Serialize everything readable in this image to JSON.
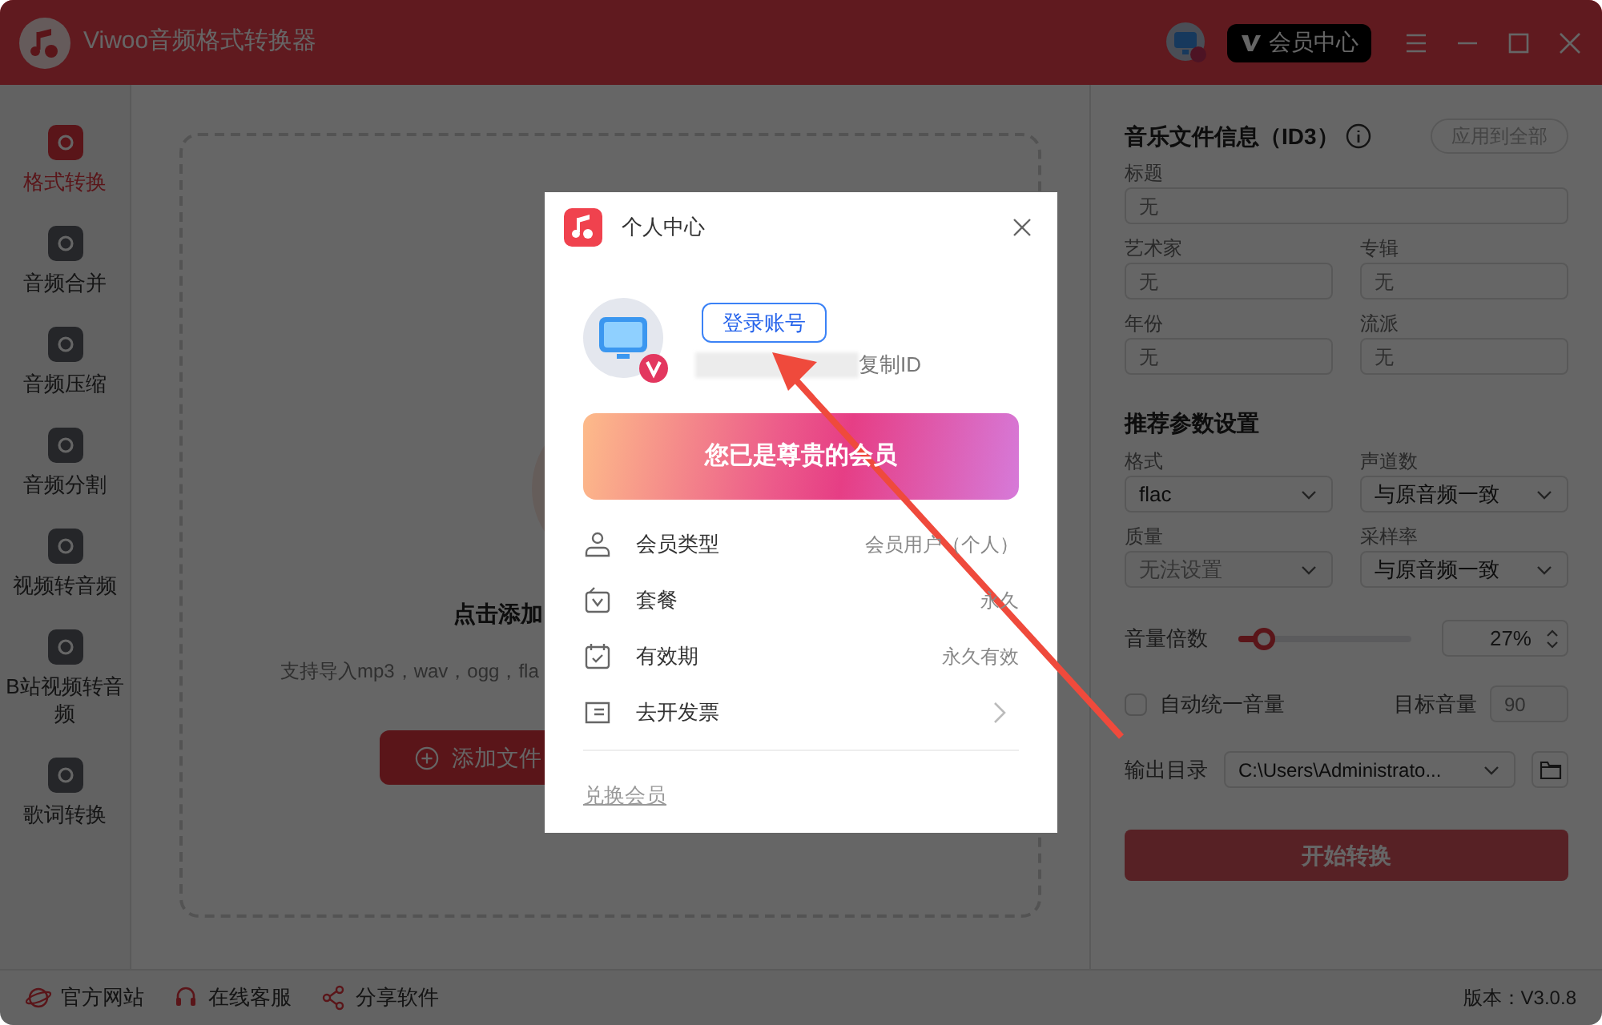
{
  "window": {
    "title": "Viwoo音频格式转换器",
    "member_button": "会员中心"
  },
  "sidebar": {
    "items": [
      {
        "label": "格式转换",
        "selected": true
      },
      {
        "label": "音频合并",
        "selected": false
      },
      {
        "label": "音频压缩",
        "selected": false
      },
      {
        "label": "音频分割",
        "selected": false
      },
      {
        "label": "视频转音频",
        "selected": false
      },
      {
        "label": "B站视频转音频",
        "selected": false
      },
      {
        "label": "歌词转换",
        "selected": false
      }
    ]
  },
  "dropzone": {
    "heading": "点击添加",
    "hint": "支持导入mp3，wav，ogg，fla",
    "button": "添加文件"
  },
  "id3": {
    "title": "音乐文件信息（ID3）",
    "apply_button": "应用到全部",
    "fields": [
      {
        "label": "标题",
        "placeholder": "无",
        "wide": true
      },
      {
        "label": "艺术家",
        "placeholder": "无",
        "wide": false
      },
      {
        "label": "专辑",
        "placeholder": "无",
        "wide": false
      },
      {
        "label": "年份",
        "placeholder": "无",
        "wide": false
      },
      {
        "label": "流派",
        "placeholder": "无",
        "wide": false
      }
    ]
  },
  "params": {
    "title": "推荐参数设置",
    "selects": [
      {
        "label": "格式",
        "value": "flac",
        "disabled": false
      },
      {
        "label": "声道数",
        "value": "与原音频一致",
        "disabled": false
      },
      {
        "label": "质量",
        "value": "无法设置",
        "disabled": true
      },
      {
        "label": "采样率",
        "value": "与原音频一致",
        "disabled": false
      }
    ],
    "volume": {
      "label": "音量倍数",
      "level": 0.1,
      "reading": "27%"
    },
    "auto_volume": {
      "label": "自动统一音量",
      "checked": false
    },
    "target_volume": {
      "label": "目标音量",
      "value": "90",
      "disabled": true
    },
    "output_dir": {
      "label": "输出目录",
      "value": "C:\\Users\\Administrato..."
    },
    "start_button": {
      "label": "开始转换",
      "disabled": true
    }
  },
  "footer": {
    "links": [
      "官方网站",
      "在线客服",
      "分享软件"
    ],
    "version": "版本：V3.0.8"
  },
  "dialog": {
    "title": "个人中心",
    "login_button": "登录账号",
    "copy_id": "复制ID",
    "banner": "您已是尊贵的会员",
    "rows": [
      {
        "kind": "info",
        "label": "会员类型",
        "value": "会员用户（个人）"
      },
      {
        "kind": "info",
        "label": "套餐",
        "value": "永久"
      },
      {
        "kind": "info",
        "label": "有效期",
        "value": "永久有效"
      },
      {
        "kind": "link",
        "label": "去开发票"
      }
    ],
    "redeem_link": "兑换会员"
  }
}
